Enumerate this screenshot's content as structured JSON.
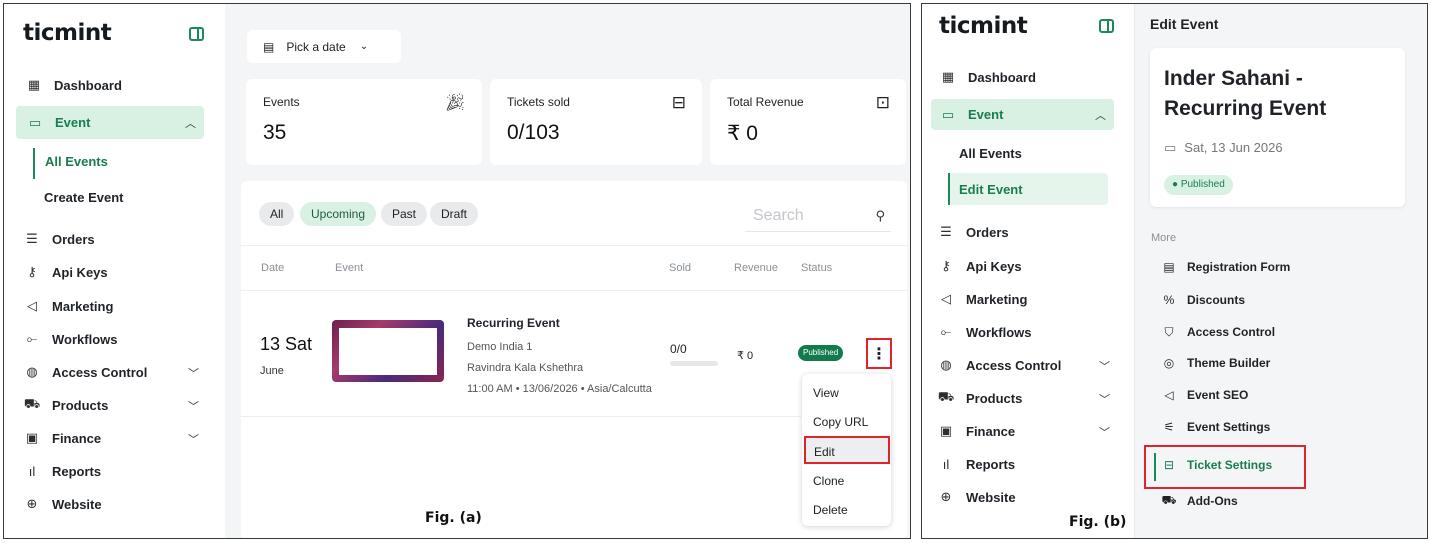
{
  "brand": {
    "logo": "ticmint",
    "accent": "#1a8a5a",
    "highlight": "#e0242a"
  },
  "fig_a": {
    "caption": "Fig. (a)",
    "sidebar": {
      "dashboard": "Dashboard",
      "event": "Event",
      "all_events": "All Events",
      "create_event": "Create Event",
      "orders": "Orders",
      "api_keys": "Api Keys",
      "marketing": "Marketing",
      "workflows": "Workflows",
      "access_control": "Access Control",
      "products": "Products",
      "finance": "Finance",
      "reports": "Reports",
      "website": "Website"
    },
    "date_picker": "Pick a date",
    "stats": [
      {
        "label": "Events",
        "value": "35",
        "icon": "party-popper-icon"
      },
      {
        "label": "Tickets sold",
        "value": "0/103",
        "icon": "ticket-icon"
      },
      {
        "label": "Total Revenue",
        "value": "₹ 0",
        "icon": "banknote-icon"
      }
    ],
    "filters": [
      "All",
      "Upcoming",
      "Past",
      "Draft"
    ],
    "active_filter": "Upcoming",
    "search_placeholder": "Search",
    "columns": [
      "Date",
      "Event",
      "Sold",
      "Revenue",
      "Status"
    ],
    "row": {
      "day": "13 Sat",
      "month": "June",
      "name": "Recurring Event",
      "organizer": "Demo India 1",
      "venue": "Ravindra Kala Kshethra",
      "when": "11:00 AM • 13/06/2026 • Asia/Calcutta",
      "sold": "0/0",
      "sold_fraction": 0,
      "revenue": "₹ 0",
      "status": "Published"
    },
    "row_menu": [
      "View",
      "Copy URL",
      "Edit",
      "Clone",
      "Delete"
    ]
  },
  "fig_b": {
    "caption": "Fig. (b)",
    "heading": "Edit Event",
    "sidebar": {
      "dashboard": "Dashboard",
      "event": "Event",
      "all_events": "All Events",
      "edit_event": "Edit Event",
      "orders": "Orders",
      "api_keys": "Api Keys",
      "marketing": "Marketing",
      "workflows": "Workflows",
      "access_control": "Access Control",
      "products": "Products",
      "finance": "Finance",
      "reports": "Reports",
      "website": "Website"
    },
    "event_card": {
      "title": "Inder Sahani - Recurring Event",
      "date": "Sat, 13 Jun 2026",
      "status": "Published"
    },
    "more_label": "More",
    "more_items": [
      "Registration Form",
      "Discounts",
      "Access Control",
      "Theme Builder",
      "Event SEO",
      "Event Settings",
      "Ticket Settings",
      "Add-Ons"
    ]
  }
}
